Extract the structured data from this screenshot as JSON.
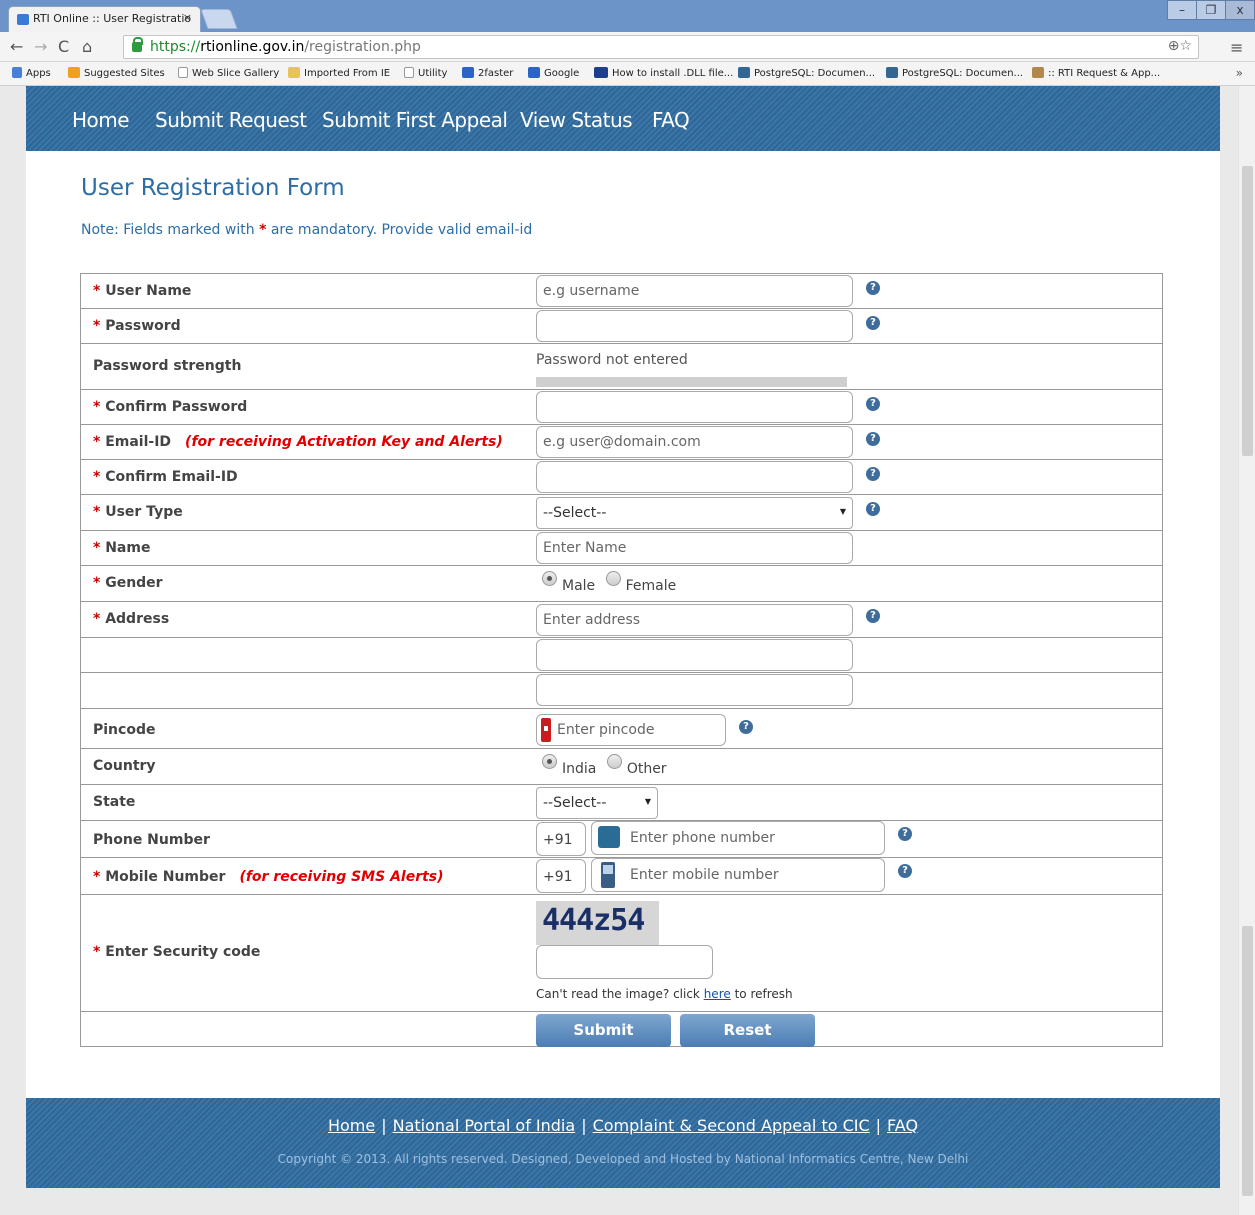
{
  "browser": {
    "tab_title": "RTI Online :: User Registratio",
    "tab_close": "×",
    "url_scheme": "https://",
    "url_host": "rtionline.gov.in",
    "url_path": "/registration.php",
    "bookmarks": [
      "Apps",
      "Suggested Sites",
      "Web Slice Gallery",
      "Imported From IE",
      "Utility",
      "2faster",
      "Google",
      "How to install .DLL file...",
      "PostgreSQL: Documen...",
      "PostgreSQL: Documen...",
      ":: RTI Request & App..."
    ],
    "bookmarks_more": "»"
  },
  "nav": [
    "Home",
    "Submit Request",
    "Submit First Appeal",
    "View Status",
    "FAQ"
  ],
  "form": {
    "title": "User Registration Form",
    "note_pre": "Note: Fields marked with",
    "note_star": "*",
    "note_post": "are mandatory. Provide valid email-id",
    "required_mark": "*",
    "help_glyph": "?",
    "fields": {
      "username": {
        "label": "User Name",
        "placeholder": "e.g username"
      },
      "password": {
        "label": "Password"
      },
      "strength": {
        "label": "Password strength",
        "value": "Password not entered",
        "level": 0
      },
      "confirm_password": {
        "label": "Confirm Password"
      },
      "email": {
        "label": "Email-ID",
        "hint": "(for receiving Activation Key and Alerts)",
        "placeholder": "e.g user@domain.com"
      },
      "confirm_email": {
        "label": "Confirm Email-ID"
      },
      "user_type": {
        "label": "User Type",
        "selected": "--Select--"
      },
      "name": {
        "label": "Name",
        "placeholder": "Enter Name"
      },
      "gender": {
        "label": "Gender",
        "options": [
          "Male",
          "Female"
        ],
        "selected": "Male"
      },
      "address": {
        "label": "Address",
        "placeholder": "Enter address"
      },
      "pincode": {
        "label": "Pincode",
        "placeholder": "Enter pincode"
      },
      "country": {
        "label": "Country",
        "options": [
          "India",
          "Other"
        ],
        "selected": "India"
      },
      "state": {
        "label": "State",
        "selected": "--Select--"
      },
      "phone": {
        "label": "Phone Number",
        "prefix": "+91",
        "placeholder": "Enter phone number"
      },
      "mobile": {
        "label": "Mobile Number",
        "hint": "(for receiving SMS Alerts)",
        "prefix": "+91",
        "placeholder": "Enter mobile number"
      },
      "security": {
        "label": "Enter Security code",
        "captcha": "444z54",
        "note_pre": "Can't read the image? click",
        "note_link": "here",
        "note_post": "to refresh"
      }
    },
    "submit_label": "Submit",
    "reset_label": "Reset"
  },
  "footer": {
    "links": [
      "Home",
      "National Portal of India",
      "Complaint & Second Appeal to CIC",
      "FAQ"
    ],
    "separator": "|",
    "copyright": "Copyright © 2013. All rights reserved. Designed, Developed and Hosted by National Informatics Centre, New Delhi"
  }
}
